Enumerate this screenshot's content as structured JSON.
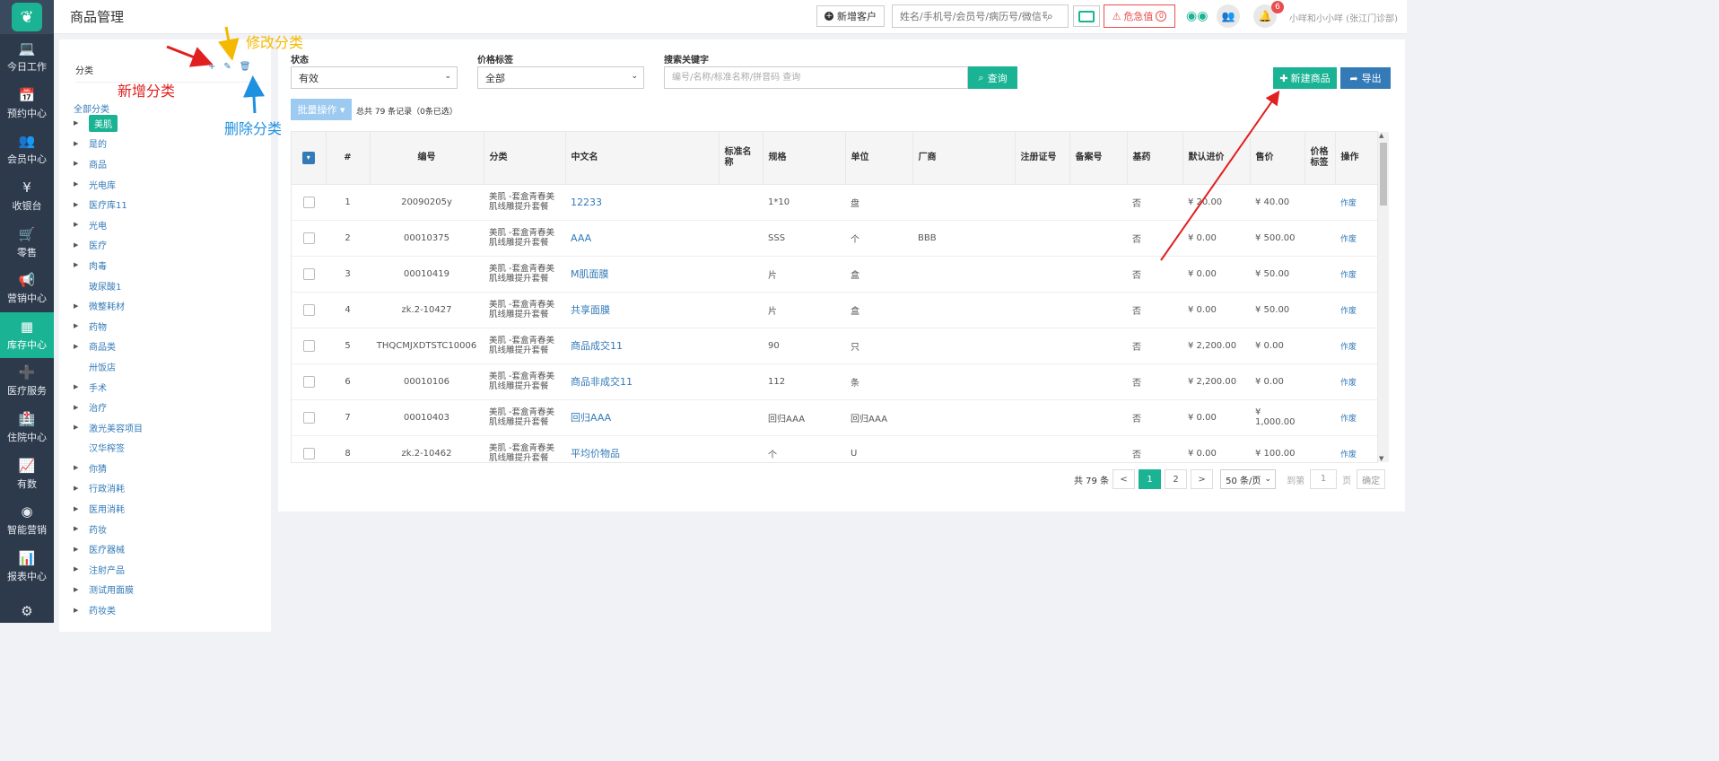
{
  "page": {
    "title": "商品管理"
  },
  "sidebar": {
    "logo_icon": "leaf-logo-icon",
    "items": [
      {
        "label": "今日工作",
        "icon": "laptop-icon",
        "glyph": "💻"
      },
      {
        "label": "预约中心",
        "icon": "calendar-icon",
        "glyph": "📅"
      },
      {
        "label": "会员中心",
        "icon": "users-icon",
        "glyph": "👥"
      },
      {
        "label": "收银台",
        "icon": "yen-icon",
        "glyph": "¥"
      },
      {
        "label": "零售",
        "icon": "cart-icon",
        "glyph": "🛒"
      },
      {
        "label": "营销中心",
        "icon": "bullhorn-icon",
        "glyph": "📢"
      },
      {
        "label": "库存中心",
        "icon": "grid-icon",
        "glyph": "▦",
        "active": true
      },
      {
        "label": "医疗服务",
        "icon": "medkit-icon",
        "glyph": "➕"
      },
      {
        "label": "住院中心",
        "icon": "building-icon",
        "glyph": "🏥"
      },
      {
        "label": "有数",
        "icon": "line-chart-icon",
        "glyph": "📈"
      },
      {
        "label": "智能营销",
        "icon": "brain-icon",
        "glyph": "◉"
      },
      {
        "label": "报表中心",
        "icon": "bar-chart-icon",
        "glyph": "📊"
      },
      {
        "label": "",
        "icon": "gear-icon",
        "glyph": "⚙"
      }
    ]
  },
  "topbar": {
    "new_customer": "新增客户",
    "search_placeholder": "姓名/手机号/会员号/病历号/微信号",
    "danger_label": "危急值",
    "danger_count": "0",
    "notif_count": "6",
    "user": "小咩和小小咩 (张江门诊部)"
  },
  "category_panel": {
    "title": "分类",
    "add_icon": "+",
    "edit_icon": "✎",
    "delete_icon": "🗑",
    "all_label": "全部分类",
    "items": [
      {
        "label": "美肌",
        "caret": "▶",
        "selected": true
      },
      {
        "label": "是的",
        "caret": "▶"
      },
      {
        "label": "商品",
        "caret": "▶"
      },
      {
        "label": "光电库",
        "caret": "▶"
      },
      {
        "label": "医疗库11",
        "caret": "▶"
      },
      {
        "label": "光电",
        "caret": "▶"
      },
      {
        "label": "医疗",
        "caret": "▶"
      },
      {
        "label": "肉毒",
        "caret": "▶"
      },
      {
        "label": "玻尿酸1",
        "caret": ""
      },
      {
        "label": "微整耗材",
        "caret": "▶"
      },
      {
        "label": "药物",
        "caret": "▶"
      },
      {
        "label": "商品类",
        "caret": "▶"
      },
      {
        "label": "卅饭店",
        "caret": ""
      },
      {
        "label": "手术",
        "caret": "▶"
      },
      {
        "label": "治疗",
        "caret": "▶"
      },
      {
        "label": "激光美容项目",
        "caret": "▶"
      },
      {
        "label": "汉华榨签",
        "caret": ""
      },
      {
        "label": "你猜",
        "caret": "▶"
      },
      {
        "label": "行政消耗",
        "caret": "▶"
      },
      {
        "label": "医用消耗",
        "caret": "▶"
      },
      {
        "label": "药妆",
        "caret": "▶"
      },
      {
        "label": "医疗器械",
        "caret": "▶"
      },
      {
        "label": "注射产品",
        "caret": "▶"
      },
      {
        "label": "测试用面膜",
        "caret": "▶"
      },
      {
        "label": "药妆类",
        "caret": "▶"
      }
    ]
  },
  "filters": {
    "status_label": "状态",
    "status_value": "有效",
    "price_tag_label": "价格标签",
    "price_tag_value": "全部",
    "keyword_label": "搜索关键字",
    "keyword_placeholder": "编号/名称/标准名称/拼音码 查询",
    "query_button": "查询",
    "new_button": "新建商品",
    "export_button": "导出",
    "batch_button": "批量操作 ▾",
    "total_text": "总共 79 条记录（0条已选）"
  },
  "table": {
    "columns": [
      "#",
      "编号",
      "分类",
      "中文名",
      "标准名称",
      "规格",
      "单位",
      "厂商",
      "注册证号",
      "备案号",
      "基药",
      "默认进价",
      "售价",
      "价格标签",
      "操作"
    ],
    "rows": [
      {
        "no": "1",
        "code": "20090205y",
        "category": "美肌 -套盒青春美肌线雕提升套餐",
        "name": "12233",
        "std": "",
        "spec": "1*10",
        "unit": "盘",
        "maker": "",
        "reg": "",
        "rec": "",
        "base": "否",
        "cost": "¥ 20.00",
        "price": "¥ 40.00",
        "tag": "",
        "op": "作废"
      },
      {
        "no": "2",
        "code": "00010375",
        "category": "美肌 -套盒青春美肌线雕提升套餐",
        "name": "AAA",
        "std": "",
        "spec": "SSS",
        "unit": "个",
        "maker": "BBB",
        "reg": "",
        "rec": "",
        "base": "否",
        "cost": "¥ 0.00",
        "price": "¥ 500.00",
        "tag": "",
        "op": "作废"
      },
      {
        "no": "3",
        "code": "00010419",
        "category": "美肌 -套盒青春美肌线雕提升套餐",
        "name": "M肌面膜",
        "std": "",
        "spec": "片",
        "unit": "盒",
        "maker": "",
        "reg": "",
        "rec": "",
        "base": "否",
        "cost": "¥ 0.00",
        "price": "¥ 50.00",
        "tag": "",
        "op": "作废"
      },
      {
        "no": "4",
        "code": "zk.2-10427",
        "category": "美肌 -套盒青春美肌线雕提升套餐",
        "name": "共享面膜",
        "std": "",
        "spec": "片",
        "unit": "盒",
        "maker": "",
        "reg": "",
        "rec": "",
        "base": "否",
        "cost": "¥ 0.00",
        "price": "¥ 50.00",
        "tag": "",
        "op": "作废"
      },
      {
        "no": "5",
        "code": "THQCMJXDTSTC10006",
        "category": "美肌 -套盒青春美肌线雕提升套餐",
        "name": "商品成交11",
        "std": "",
        "spec": "90",
        "unit": "只",
        "maker": "",
        "reg": "",
        "rec": "",
        "base": "否",
        "cost": "¥ 2,200.00",
        "price": "¥ 0.00",
        "tag": "",
        "op": "作废"
      },
      {
        "no": "6",
        "code": "00010106",
        "category": "美肌 -套盒青春美肌线雕提升套餐",
        "name": "商品非成交11",
        "std": "",
        "spec": "112",
        "unit": "条",
        "maker": "",
        "reg": "",
        "rec": "",
        "base": "否",
        "cost": "¥ 2,200.00",
        "price": "¥ 0.00",
        "tag": "",
        "op": "作废"
      },
      {
        "no": "7",
        "code": "00010403",
        "category": "美肌 -套盒青春美肌线雕提升套餐",
        "name": "回归AAA",
        "std": "",
        "spec": "回归AAA",
        "unit": "回归AAA",
        "maker": "",
        "reg": "",
        "rec": "",
        "base": "否",
        "cost": "¥ 0.00",
        "price": "¥ 1,000.00",
        "tag": "",
        "op": "作废"
      },
      {
        "no": "8",
        "code": "zk.2-10462",
        "category": "美肌 -套盒青春美肌线雕提升套餐",
        "name": "平均价物品",
        "std": "",
        "spec": "个",
        "unit": "U",
        "maker": "",
        "reg": "",
        "rec": "",
        "base": "否",
        "cost": "¥ 0.00",
        "price": "¥ 100.00",
        "tag": "",
        "op": "作废"
      }
    ]
  },
  "pagination": {
    "total": "共 79 条",
    "prev": "<",
    "pages": [
      "1",
      "2"
    ],
    "current": "1",
    "next": ">",
    "page_size": "50 条/页",
    "goto": "到第",
    "goto_value": "1",
    "page_unit": "页",
    "confirm": "确定"
  },
  "annotations": {
    "add": "新增分类",
    "edit": "修改分类",
    "delete": "删除分类",
    "add_color": "#e02020",
    "edit_color": "#f5b800",
    "delete_color": "#1e90e0"
  }
}
